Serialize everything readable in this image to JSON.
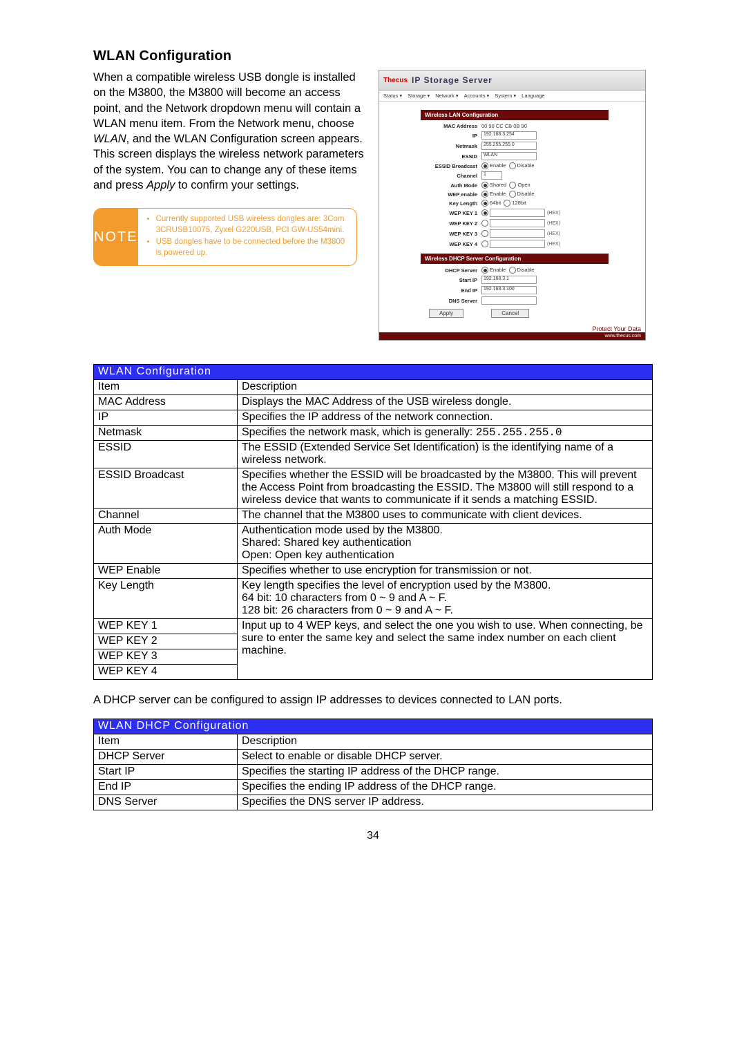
{
  "heading": "WLAN Configuration",
  "intro_parts": {
    "p1": "When a compatible wireless USB dongle is installed on the M3800, the M3800 will become an access point, and the Network dropdown menu will contain a WLAN menu item. From the Network menu, choose ",
    "p1_em": "WLAN",
    "p2": ", and the WLAN Configuration screen appears. This screen displays the wireless network parameters of the system. You can to change any of these items and press ",
    "p2_em": "Apply",
    "p3": " to confirm your settings."
  },
  "note": {
    "label": "NOTE",
    "bullets": [
      "Currently supported USB wireless dongles are: 3Com 3CRUSB10075, Zyxel G220USB, PCI GW-US54mini.",
      "USB dongles have to be connected before the M3800 is powered up."
    ]
  },
  "screenshot": {
    "logo": "Thecus",
    "title": "IP Storage Server",
    "menu": [
      "Status ▾",
      "Storage ▾",
      "Network ▾",
      "Accounts ▾",
      "System ▾",
      "Language"
    ],
    "section1": "Wireless LAN Configuration",
    "rows": {
      "mac_label": "MAC Address",
      "mac_val": "00 90 CC CB 0B 90",
      "ip_label": "IP",
      "ip_val": "192.168.3.254",
      "netmask_label": "Netmask",
      "netmask_val": "255.255.255.0",
      "essid_label": "ESSID",
      "essid_val": "WLAN",
      "essidb_label": "ESSID Broadcast",
      "enable": "Enable",
      "disable": "Disable",
      "channel_label": "Channel",
      "channel_val": "1",
      "auth_label": "Auth Mode",
      "shared": "Shared",
      "open": "Open",
      "wep_label": "WEP enable",
      "keylen_label": "Key Length",
      "k64": "64bit",
      "k128": "128bit",
      "wep1": "WEP KEY 1",
      "wep2": "WEP KEY 2",
      "wep3": "WEP KEY 3",
      "wep4": "WEP KEY 4",
      "hex": "(HEX)"
    },
    "section2": "Wireless DHCP Server Configuration",
    "dhcp": {
      "server_label": "DHCP Server",
      "start_label": "Start IP",
      "start_val": "192.168.3.1",
      "end_label": "End IP",
      "end_val": "192.168.3.100",
      "dns_label": "DNS Server"
    },
    "apply": "Apply",
    "cancel": "Cancel",
    "footer1": "Protect Your Data",
    "footer2": "www.thecus.com"
  },
  "table1": {
    "title": "WLAN Configuration",
    "h_item": "Item",
    "h_desc": "Description",
    "rows": [
      {
        "item": "MAC Address",
        "desc": "Displays the MAC Address of the USB wireless dongle."
      },
      {
        "item": "IP",
        "desc": "Specifies the IP address of the network connection."
      },
      {
        "item": "Netmask",
        "desc": "Specifies the network mask, which is generally: ",
        "mono": "255.255.255.0"
      },
      {
        "item": "ESSID",
        "desc": "The ESSID (Extended Service Set Identification) is the identifying name of a wireless network."
      },
      {
        "item": "ESSID Broadcast",
        "desc": "Specifies whether the ESSID will be broadcasted by the M3800. This will prevent the Access Point from broadcasting the ESSID. The M3800 will still respond to a wireless device that wants to communicate if it sends a matching ESSID."
      },
      {
        "item": "Channel",
        "desc": "The channel that the M3800 uses to communicate with client devices."
      },
      {
        "item": "Auth Mode",
        "desc": "Authentication mode used by the M3800.\nShared: Shared key authentication\nOpen: Open key authentication"
      },
      {
        "item": "WEP Enable",
        "desc": "Specifies whether to use encryption for transmission or not."
      },
      {
        "item": "Key Length",
        "desc": "Key length specifies the level of encryption used by the M3800.\n64 bit: 10 characters from 0 ~ 9 and A ~ F.\n128 bit: 26 characters from 0 ~ 9 and A ~ F."
      }
    ],
    "wep_group": {
      "items": [
        "WEP KEY 1",
        "WEP KEY 2",
        "WEP KEY 3",
        "WEP KEY 4"
      ],
      "desc": "Input up to 4 WEP keys, and select the one you wish to use. When connecting, be sure to enter the same key and select the same index number on each client machine."
    }
  },
  "mid_para": "A DHCP server can be configured to assign IP addresses to devices connected to LAN ports.",
  "table2": {
    "title": "WLAN DHCP Configuration",
    "h_item": "Item",
    "h_desc": "Description",
    "rows": [
      {
        "item": "DHCP Server",
        "desc": "Select to enable or disable DHCP server."
      },
      {
        "item": "Start IP",
        "desc": "Specifies the starting IP address of the DHCP range."
      },
      {
        "item": "End IP",
        "desc": "Specifies the ending IP address of the DHCP range."
      },
      {
        "item": "DNS Server",
        "desc": "Specifies the DNS server IP address."
      }
    ]
  },
  "page_num": "34"
}
